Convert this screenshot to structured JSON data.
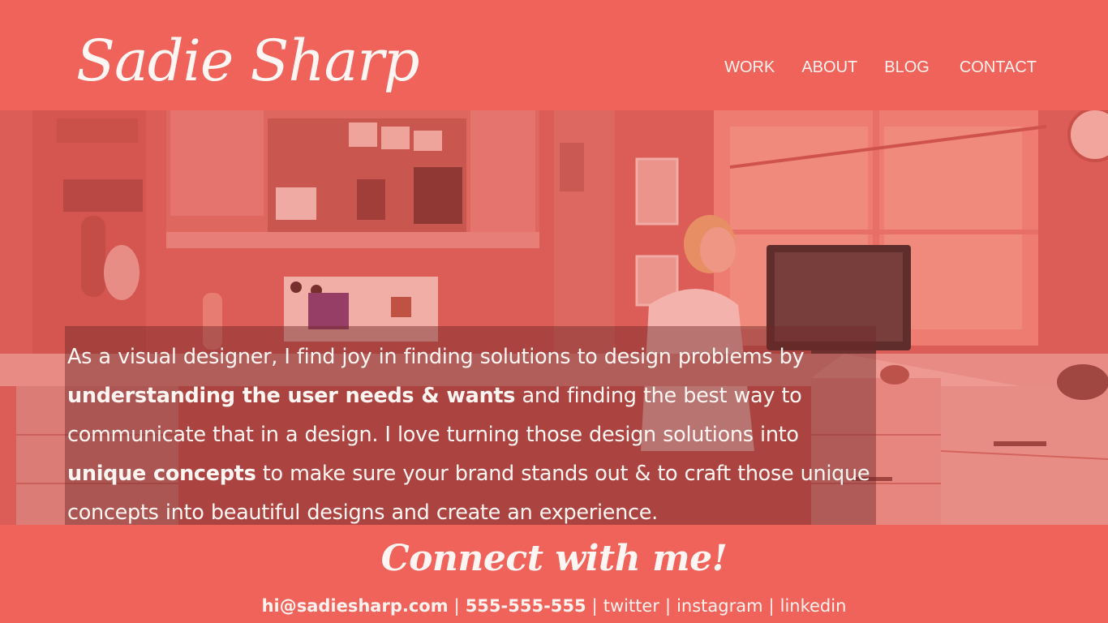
{
  "header": {
    "logo_text": "Sadie Sharp",
    "nav": {
      "work": "WORK",
      "about": "ABOUT",
      "blog": "BLOG",
      "contact": "CONTACT"
    }
  },
  "hero": {
    "image_description_icon": "home-office-photo",
    "intro": {
      "part1": "As a visual designer, I find joy in finding solutions to design problems by ",
      "bold1": "understanding the user needs & wants",
      "part2": " and finding the best way to communicate that in a design. I love turning those design solutions into ",
      "bold2": "unique concepts",
      "part3": " to make sure your brand stands out & to craft those unique concepts into beautiful designs and create an experience."
    }
  },
  "footer": {
    "title": "Connect with me!",
    "email": "hi@sadiesharp.com",
    "phone": "555-555-555",
    "twitter": "twitter",
    "instagram": "instagram",
    "linkedin": "linkedin",
    "separator": "|"
  },
  "colors": {
    "brand": "#ef635b",
    "text": "#fff4f2"
  }
}
